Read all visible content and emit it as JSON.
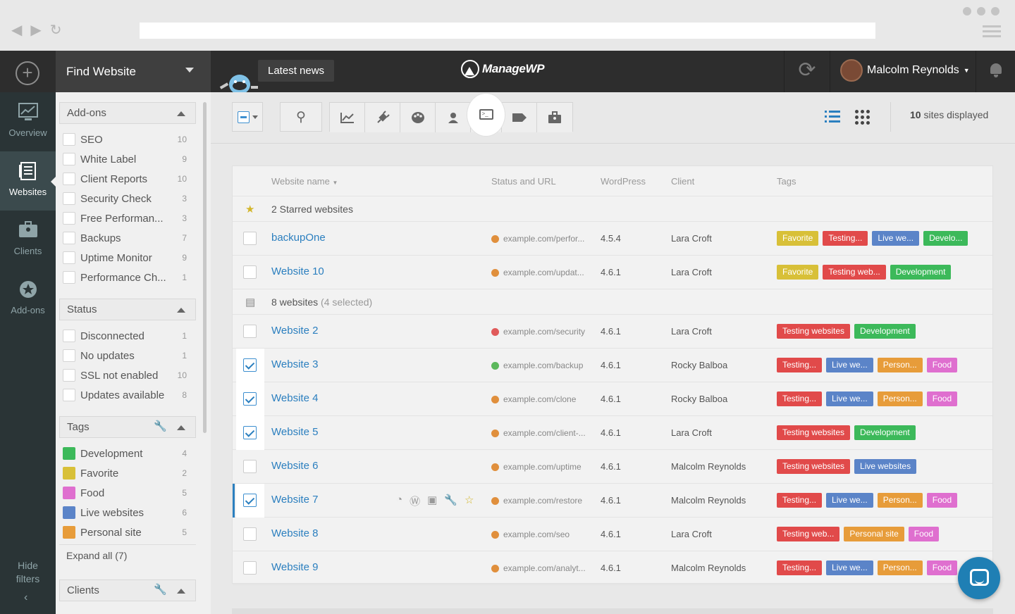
{
  "topbar": {
    "find_label": "Find Website",
    "latest_news": "Latest news",
    "logo": "ManageWP",
    "user": "Malcolm Reynolds"
  },
  "leftnav": {
    "items": [
      {
        "label": "Overview",
        "icon": "chart-icon"
      },
      {
        "label": "Websites",
        "icon": "websites-icon"
      },
      {
        "label": "Clients",
        "icon": "clients-icon"
      },
      {
        "label": "Add-ons",
        "icon": "addons-icon"
      }
    ],
    "hide_filters": "Hide filters"
  },
  "filters": {
    "addons": {
      "title": "Add-ons",
      "items": [
        {
          "label": "SEO",
          "count": "10"
        },
        {
          "label": "White Label",
          "count": "9"
        },
        {
          "label": "Client Reports",
          "count": "10"
        },
        {
          "label": "Security Check",
          "count": "3"
        },
        {
          "label": "Free Performan...",
          "count": "3"
        },
        {
          "label": "Backups",
          "count": "7"
        },
        {
          "label": "Uptime Monitor",
          "count": "9"
        },
        {
          "label": "Performance Ch...",
          "count": "1"
        }
      ]
    },
    "status": {
      "title": "Status",
      "items": [
        {
          "label": "Disconnected",
          "count": "1"
        },
        {
          "label": "No updates",
          "count": "1"
        },
        {
          "label": "SSL not enabled",
          "count": "10"
        },
        {
          "label": "Updates available",
          "count": "8"
        }
      ]
    },
    "tags": {
      "title": "Tags",
      "items": [
        {
          "label": "Development",
          "count": "4",
          "color": "#3cb95a"
        },
        {
          "label": "Favorite",
          "count": "2",
          "color": "#d8c038"
        },
        {
          "label": "Food",
          "count": "5",
          "color": "#df6fcf"
        },
        {
          "label": "Live websites",
          "count": "6",
          "color": "#5b84c8"
        },
        {
          "label": "Personal site",
          "count": "5",
          "color": "#e79c3a"
        }
      ],
      "expand": "Expand all (7)"
    },
    "clients": {
      "title": "Clients"
    }
  },
  "main": {
    "sites_count": "10",
    "sites_suffix": "sites displayed",
    "columns": [
      "Website name",
      "Status and URL",
      "WordPress",
      "Client",
      "Tags"
    ],
    "starred_group": "2 Starred websites",
    "all_group": "8 websites",
    "all_group_sel": "(4 selected)",
    "rows": [
      {
        "name": "backupOne",
        "url": "example.com/perfor...",
        "wp": "4.5.4",
        "client": "Lara Croft",
        "status": "#e08f3c",
        "sel": false,
        "tags": [
          {
            "t": "Favorite",
            "c": "#d8c038"
          },
          {
            "t": "Testing...",
            "c": "#e14a4a"
          },
          {
            "t": "Live we...",
            "c": "#5b84c8"
          },
          {
            "t": "Develo...",
            "c": "#3cb95a"
          }
        ]
      },
      {
        "name": "Website 10",
        "url": "example.com/updat...",
        "wp": "4.6.1",
        "client": "Lara Croft",
        "status": "#e08f3c",
        "sel": false,
        "tags": [
          {
            "t": "Favorite",
            "c": "#d8c038"
          },
          {
            "t": "Testing web...",
            "c": "#e14a4a"
          },
          {
            "t": "Development",
            "c": "#3cb95a"
          }
        ]
      },
      {
        "name": "Website 2",
        "url": "example.com/security",
        "wp": "4.6.1",
        "client": "Lara Croft",
        "status": "#e05a5a",
        "sel": false,
        "tags": [
          {
            "t": "Testing websites",
            "c": "#e14a4a"
          },
          {
            "t": "Development",
            "c": "#3cb95a"
          }
        ]
      },
      {
        "name": "Website 3",
        "url": "example.com/backup",
        "wp": "4.6.1",
        "client": "Rocky Balboa",
        "status": "#5cb85c",
        "sel": true,
        "tags": [
          {
            "t": "Testing...",
            "c": "#e14a4a"
          },
          {
            "t": "Live we...",
            "c": "#5b84c8"
          },
          {
            "t": "Person...",
            "c": "#e79c3a"
          },
          {
            "t": "Food",
            "c": "#df6fcf"
          }
        ]
      },
      {
        "name": "Website 4",
        "url": "example.com/clone",
        "wp": "4.6.1",
        "client": "Rocky Balboa",
        "status": "#e08f3c",
        "sel": true,
        "tags": [
          {
            "t": "Testing...",
            "c": "#e14a4a"
          },
          {
            "t": "Live we...",
            "c": "#5b84c8"
          },
          {
            "t": "Person...",
            "c": "#e79c3a"
          },
          {
            "t": "Food",
            "c": "#df6fcf"
          }
        ]
      },
      {
        "name": "Website 5",
        "url": "example.com/client-...",
        "wp": "4.6.1",
        "client": "Lara Croft",
        "status": "#e08f3c",
        "sel": true,
        "tags": [
          {
            "t": "Testing websites",
            "c": "#e14a4a"
          },
          {
            "t": "Development",
            "c": "#3cb95a"
          }
        ]
      },
      {
        "name": "Website 6",
        "url": "example.com/uptime",
        "wp": "4.6.1",
        "client": "Malcolm Reynolds",
        "status": "#e08f3c",
        "sel": false,
        "tags": [
          {
            "t": "Testing websites",
            "c": "#e14a4a"
          },
          {
            "t": "Live websites",
            "c": "#5b84c8"
          }
        ]
      },
      {
        "name": "Website 7",
        "url": "example.com/restore",
        "wp": "4.6.1",
        "client": "Malcolm Reynolds",
        "status": "#e08f3c",
        "sel": true,
        "hover": true,
        "tags": [
          {
            "t": "Testing...",
            "c": "#e14a4a"
          },
          {
            "t": "Live we...",
            "c": "#5b84c8"
          },
          {
            "t": "Person...",
            "c": "#e79c3a"
          },
          {
            "t": "Food",
            "c": "#df6fcf"
          }
        ]
      },
      {
        "name": "Website 8",
        "url": "example.com/seo",
        "wp": "4.6.1",
        "client": "Lara Croft",
        "status": "#e08f3c",
        "sel": false,
        "tags": [
          {
            "t": "Testing web...",
            "c": "#e14a4a"
          },
          {
            "t": "Personal site",
            "c": "#e79c3a"
          },
          {
            "t": "Food",
            "c": "#df6fcf"
          }
        ]
      },
      {
        "name": "Website 9",
        "url": "example.com/analyt...",
        "wp": "4.6.1",
        "client": "Malcolm Reynolds",
        "status": "#e08f3c",
        "sel": false,
        "tags": [
          {
            "t": "Testing...",
            "c": "#e14a4a"
          },
          {
            "t": "Live we...",
            "c": "#5b84c8"
          },
          {
            "t": "Person...",
            "c": "#e79c3a"
          },
          {
            "t": "Food",
            "c": "#df6fcf"
          }
        ]
      }
    ]
  }
}
